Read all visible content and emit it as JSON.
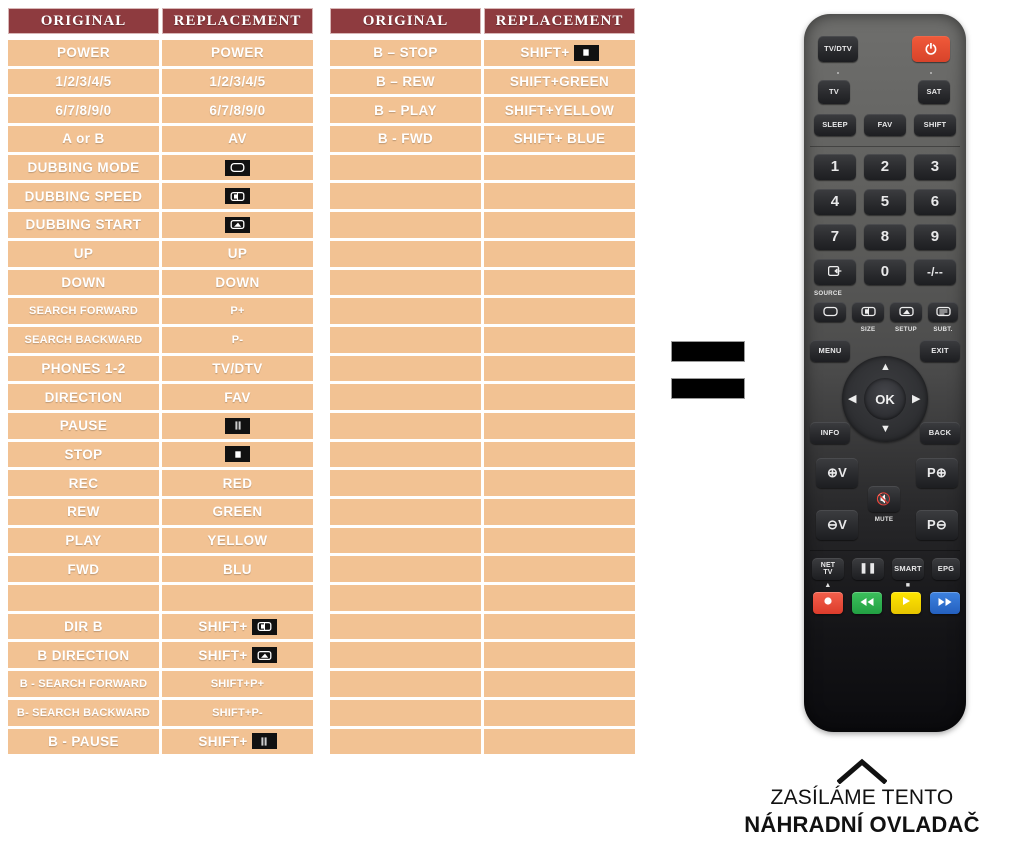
{
  "tables": [
    {
      "id": "table-1",
      "headers": [
        "ORIGINAL",
        "REPLACEMENT"
      ],
      "rows": [
        {
          "original": "POWER",
          "replacement": "POWER",
          "small": false,
          "icon": null
        },
        {
          "original": "1/2/3/4/5",
          "replacement": "1/2/3/4/5",
          "small": false,
          "icon": null
        },
        {
          "original": "6/7/8/9/0",
          "replacement": "6/7/8/9/0",
          "small": false,
          "icon": null
        },
        {
          "original": "A or B",
          "replacement": "AV",
          "small": false,
          "icon": null
        },
        {
          "original": "DUBBING MODE",
          "replacement": "",
          "small": false,
          "icon": "screen-icon"
        },
        {
          "original": "DUBBING SPEED",
          "replacement": "",
          "small": false,
          "icon": "screen-size-icon"
        },
        {
          "original": "DUBBING START",
          "replacement": "",
          "small": false,
          "icon": "screen-setup-icon"
        },
        {
          "original": "UP",
          "replacement": "UP",
          "small": false,
          "icon": null
        },
        {
          "original": "DOWN",
          "replacement": "DOWN",
          "small": false,
          "icon": null
        },
        {
          "original": "SEARCH FORWARD",
          "replacement": "P+",
          "small": true,
          "icon": null
        },
        {
          "original": "SEARCH BACKWARD",
          "replacement": "P-",
          "small": true,
          "icon": null
        },
        {
          "original": "PHONES 1-2",
          "replacement": "TV/DTV",
          "small": false,
          "icon": null
        },
        {
          "original": "DIRECTION",
          "replacement": "FAV",
          "small": false,
          "icon": null
        },
        {
          "original": "PAUSE",
          "replacement": "",
          "small": false,
          "icon": "pause-icon"
        },
        {
          "original": "STOP",
          "replacement": "",
          "small": false,
          "icon": "stop-icon"
        },
        {
          "original": "REC",
          "replacement": "RED",
          "small": false,
          "icon": null
        },
        {
          "original": "REW",
          "replacement": "GREEN",
          "small": false,
          "icon": null
        },
        {
          "original": "PLAY",
          "replacement": "YELLOW",
          "small": false,
          "icon": null
        },
        {
          "original": "FWD",
          "replacement": "BLU",
          "small": false,
          "icon": null
        },
        {
          "original": "",
          "replacement": "",
          "small": false,
          "icon": null
        },
        {
          "original": "DIR B",
          "replacement": "SHIFT+",
          "small": false,
          "icon": "screen-size-icon"
        },
        {
          "original": "B DIRECTION",
          "replacement": "SHIFT+",
          "small": false,
          "icon": "screen-setup-icon"
        },
        {
          "original": "B - SEARCH FORWARD",
          "replacement": "SHIFT+P+",
          "small": true,
          "icon": null
        },
        {
          "original": "B- SEARCH BACKWARD",
          "replacement": "SHIFT+P-",
          "small": true,
          "icon": null
        },
        {
          "original": "B - PAUSE",
          "replacement": "SHIFT+",
          "small": false,
          "icon": "pause-icon"
        }
      ]
    },
    {
      "id": "table-2",
      "headers": [
        "ORIGINAL",
        "REPLACEMENT"
      ],
      "rows": [
        {
          "original": "B – STOP",
          "replacement": "SHIFT+",
          "small": false,
          "icon": "stop-icon"
        },
        {
          "original": "B – REW",
          "replacement": "SHIFT+GREEN",
          "small": false,
          "icon": null
        },
        {
          "original": "B – PLAY",
          "replacement": "SHIFT+YELLOW",
          "small": false,
          "icon": null
        },
        {
          "original": "B - FWD",
          "replacement": "SHIFT+ BLUE",
          "small": false,
          "icon": null
        },
        {
          "original": "",
          "replacement": "",
          "small": false,
          "icon": null
        },
        {
          "original": "",
          "replacement": "",
          "small": false,
          "icon": null
        },
        {
          "original": "",
          "replacement": "",
          "small": false,
          "icon": null
        },
        {
          "original": "",
          "replacement": "",
          "small": false,
          "icon": null
        },
        {
          "original": "",
          "replacement": "",
          "small": false,
          "icon": null
        },
        {
          "original": "",
          "replacement": "",
          "small": false,
          "icon": null
        },
        {
          "original": "",
          "replacement": "",
          "small": false,
          "icon": null
        },
        {
          "original": "",
          "replacement": "",
          "small": false,
          "icon": null
        },
        {
          "original": "",
          "replacement": "",
          "small": false,
          "icon": null
        },
        {
          "original": "",
          "replacement": "",
          "small": false,
          "icon": null
        },
        {
          "original": "",
          "replacement": "",
          "small": false,
          "icon": null
        },
        {
          "original": "",
          "replacement": "",
          "small": false,
          "icon": null
        },
        {
          "original": "",
          "replacement": "",
          "small": false,
          "icon": null
        },
        {
          "original": "",
          "replacement": "",
          "small": false,
          "icon": null
        },
        {
          "original": "",
          "replacement": "",
          "small": false,
          "icon": null
        },
        {
          "original": "",
          "replacement": "",
          "small": false,
          "icon": null
        },
        {
          "original": "",
          "replacement": "",
          "small": false,
          "icon": null
        },
        {
          "original": "",
          "replacement": "",
          "small": false,
          "icon": null
        },
        {
          "original": "",
          "replacement": "",
          "small": false,
          "icon": null
        },
        {
          "original": "",
          "replacement": "",
          "small": false,
          "icon": null
        },
        {
          "original": "",
          "replacement": "",
          "small": false,
          "icon": null
        }
      ]
    }
  ],
  "equals_sign": {
    "name": "equals-sign",
    "bars": 2
  },
  "remote": {
    "name": "replacement-remote-control",
    "buttons": {
      "tv_dtv": "TV/DTV",
      "power": "power-icon",
      "tv": "TV",
      "sat": "SAT",
      "sleep": "SLEEP",
      "fav": "FAV",
      "shift": "SHIFT",
      "n1": "1",
      "n2": "2",
      "n3": "3",
      "n4": "4",
      "n5": "5",
      "n6": "6",
      "n7": "7",
      "n8": "8",
      "n9": "9",
      "source": "SOURCE",
      "n0": "0",
      "dash": "-/--",
      "size": "SIZE",
      "setup": "SETUP",
      "subt": "SUBT.",
      "menu": "MENU",
      "exit": "EXIT",
      "ok": "OK",
      "info": "INFO",
      "back": "BACK",
      "vol_up": "V",
      "vol_down": "V",
      "mute": "MUTE",
      "prog_up": "P",
      "prog_down": "P",
      "net_tv": "NET\nTV",
      "net_tv_line1": "NET",
      "net_tv_line2": "TV",
      "pause": "pause-icon",
      "smart": "SMART",
      "epg": "EPG",
      "record": "record-icon",
      "rewind": "rewind-icon",
      "play": "play-icon",
      "forward": "forward-icon"
    },
    "colors": {
      "power_key": "#e0492d",
      "record_key": "#ec4b3c",
      "rewind_key": "#2faa49",
      "play_key": "#f4d400",
      "forward_key": "#2f6fd0",
      "body": "#4a4a4a"
    }
  },
  "caption": {
    "chevron": "chevron-up-icon",
    "line1": "ZASÍLÁME TENTO",
    "line2": "NÁHRADNÍ OVLADAČ"
  },
  "palette": {
    "header_bg": "#8e3b3f",
    "cell_bg": "#f2c293",
    "cell_text": "#ffffff",
    "chip_bg": "#111111",
    "page_bg": "#ffffff"
  }
}
